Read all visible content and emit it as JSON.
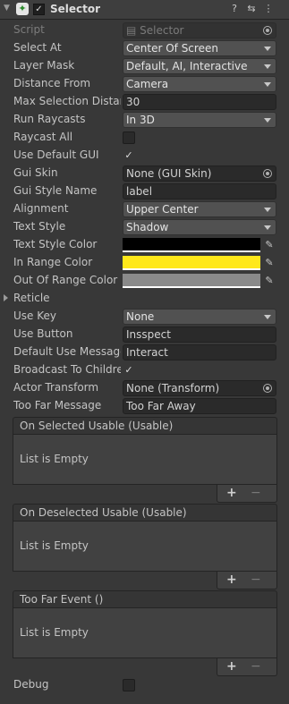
{
  "header": {
    "title": "Selector",
    "enabled_check": "✓",
    "help_icon": "help-icon",
    "presets_icon": "presets-icon",
    "menu_icon": "kebab-menu-icon"
  },
  "fields": {
    "script": {
      "label": "Script",
      "value": "Selector"
    },
    "select_at": {
      "label": "Select At",
      "value": "Center Of Screen"
    },
    "layer_mask": {
      "label": "Layer Mask",
      "value": "Default, AI, Interactive"
    },
    "distance_from": {
      "label": "Distance From",
      "value": "Camera"
    },
    "max_selection_distance": {
      "label": "Max Selection Distan",
      "value": "30"
    },
    "run_raycasts": {
      "label": "Run Raycasts",
      "value": "In 3D"
    },
    "raycast_all": {
      "label": "Raycast All",
      "checked": false
    },
    "use_default_gui": {
      "label": "Use Default GUI",
      "checked": true,
      "check_mark": "✓"
    },
    "gui_skin": {
      "label": "Gui Skin",
      "value": "None (GUI Skin)"
    },
    "gui_style_name": {
      "label": "Gui Style Name",
      "value": "label"
    },
    "alignment": {
      "label": "Alignment",
      "value": "Upper Center"
    },
    "text_style": {
      "label": "Text Style",
      "value": "Shadow"
    },
    "text_style_color": {
      "label": "Text Style Color",
      "color": "#000000"
    },
    "in_range_color": {
      "label": "In Range Color",
      "color": "#ffe81a"
    },
    "out_of_range_color": {
      "label": "Out Of Range Color",
      "color": "#8a8a8a"
    },
    "reticle": {
      "label": "Reticle"
    },
    "use_key": {
      "label": "Use Key",
      "value": "None"
    },
    "use_button": {
      "label": "Use Button",
      "value": "Insspect"
    },
    "default_use_message": {
      "label": "Default Use Message",
      "value": "Interact"
    },
    "broadcast_to_children": {
      "label": "Broadcast To Childre",
      "checked": true,
      "check_mark": "✓"
    },
    "actor_transform": {
      "label": "Actor Transform",
      "value": "None (Transform)"
    },
    "too_far_message": {
      "label": "Too Far Message",
      "value": "Too Far Away"
    },
    "debug": {
      "label": "Debug",
      "checked": false
    }
  },
  "events": [
    {
      "title": "On Selected Usable (Usable)",
      "empty_text": "List is Empty",
      "add_label": "+",
      "remove_label": "−"
    },
    {
      "title": "On Deselected Usable (Usable)",
      "empty_text": "List is Empty",
      "add_label": "+",
      "remove_label": "−"
    },
    {
      "title": "Too Far Event ()",
      "empty_text": "List is Empty",
      "add_label": "+",
      "remove_label": "−"
    }
  ],
  "colors": {
    "background": "#383838",
    "field": "#2a2a2a",
    "dropdown": "#515151",
    "text": "#c4c4c4"
  }
}
